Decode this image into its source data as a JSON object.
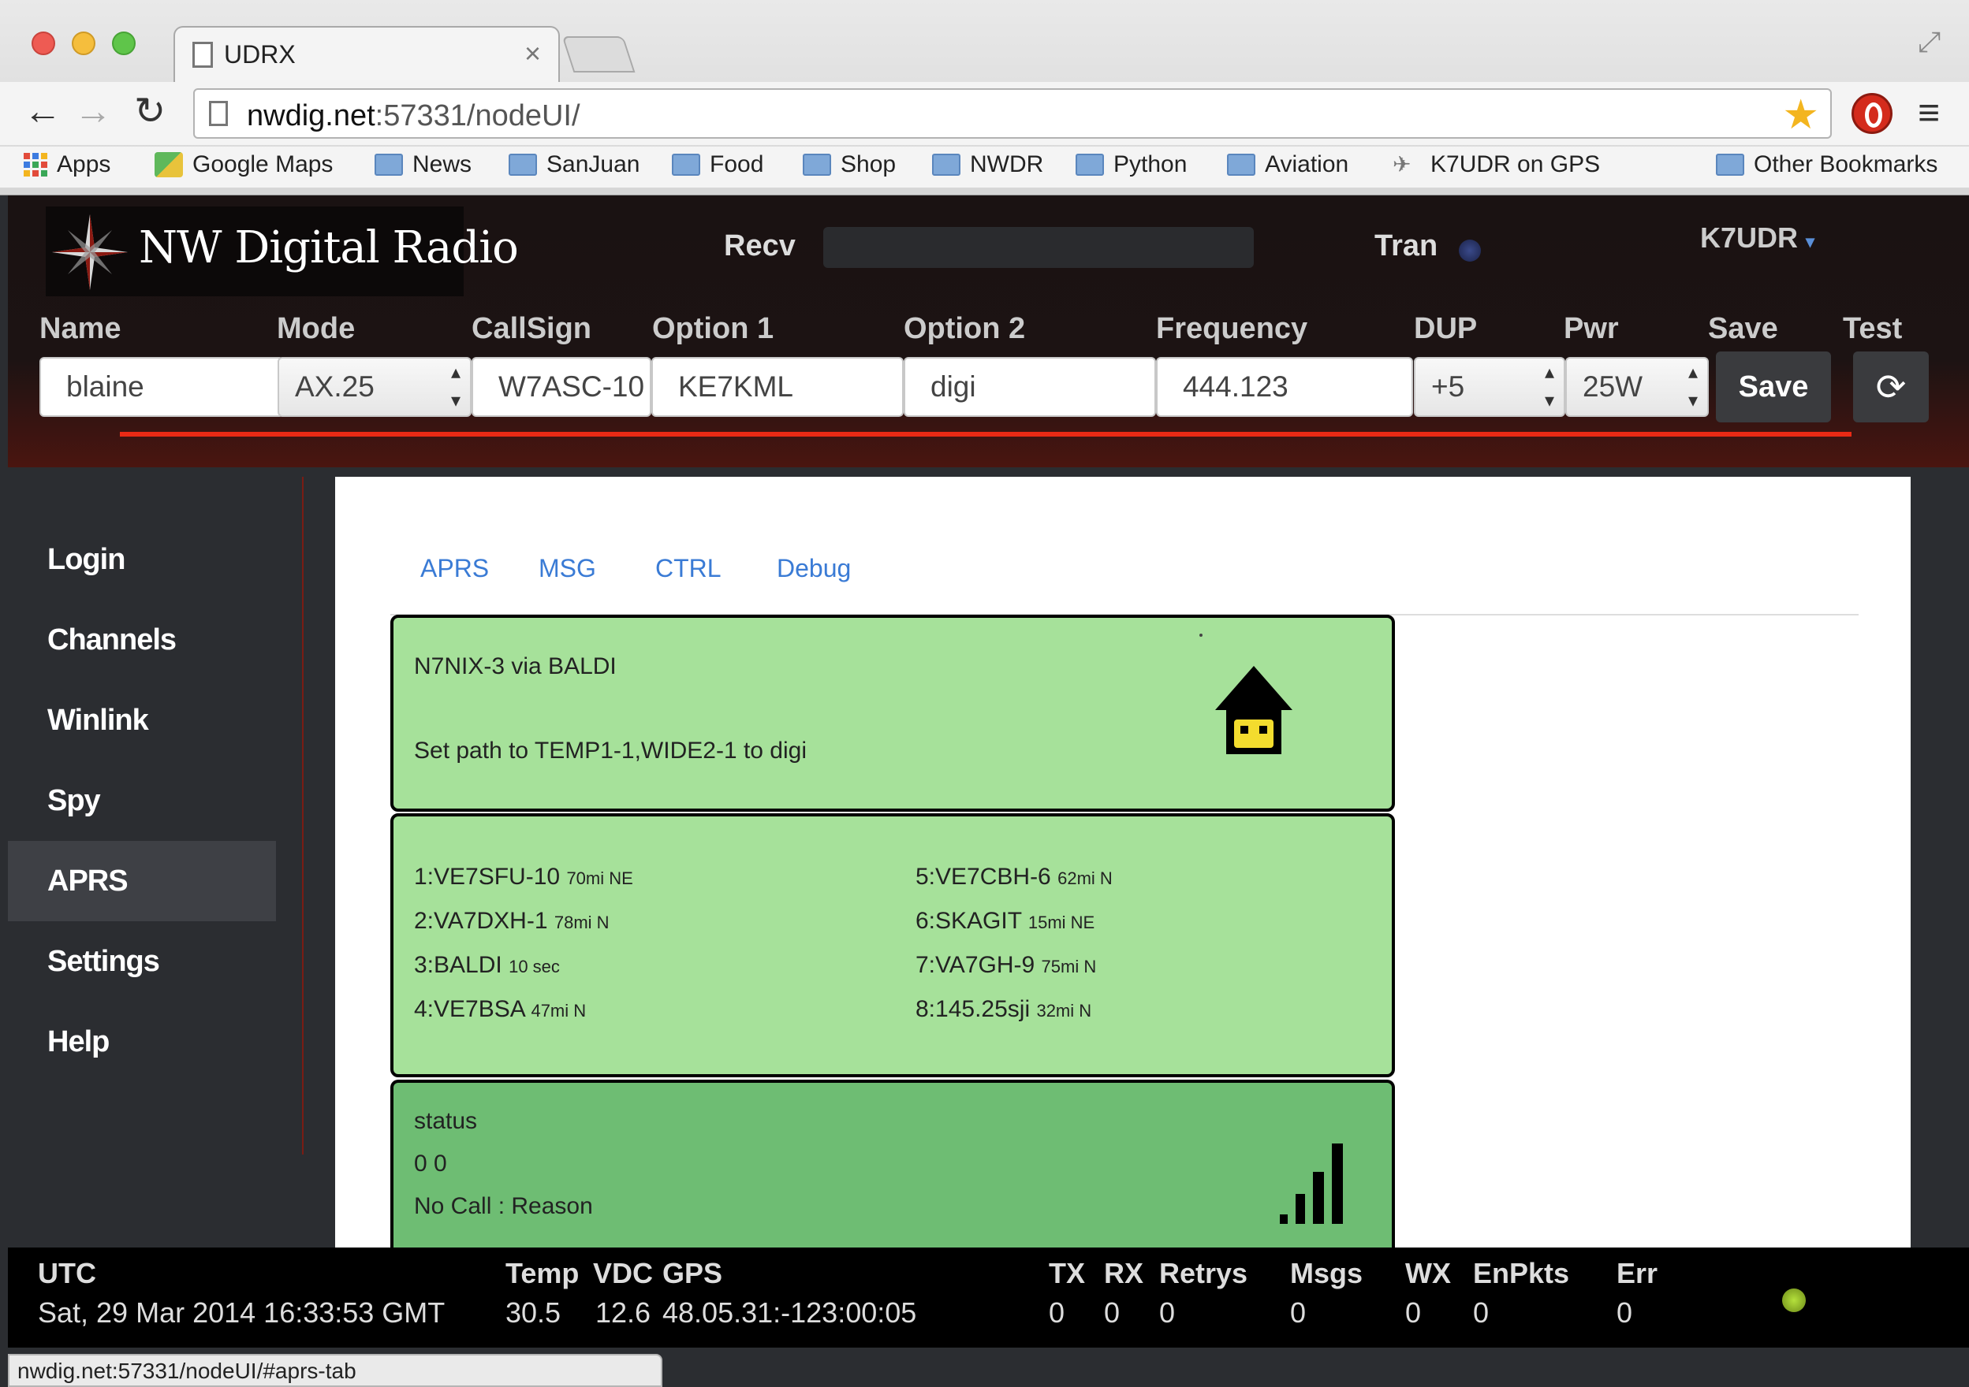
{
  "browser": {
    "tab_title": "UDRX",
    "url_host": "nwdig.net",
    "url_rest": ":57331/nodeUI/",
    "bookmarks": [
      "Apps",
      "Google Maps",
      "News",
      "SanJuan",
      "Food",
      "Shop",
      "NWDR",
      "Python",
      "Aviation",
      "K7UDR on GPS"
    ],
    "other_bookmarks": "Other Bookmarks",
    "status_url": "nwdig.net:57331/nodeUI/#aprs-tab"
  },
  "header": {
    "logo_text": "NW Digital Radio",
    "recv_label": "Recv",
    "tran_label": "Tran",
    "user": "K7UDR",
    "columns": {
      "name": "Name",
      "mode": "Mode",
      "callsign": "CallSign",
      "option1": "Option 1",
      "option2": "Option 2",
      "frequency": "Frequency",
      "dup": "DUP",
      "pwr": "Pwr",
      "save": "Save",
      "test": "Test"
    },
    "values": {
      "name": "blaine",
      "mode": "AX.25",
      "callsign": "W7ASC-10",
      "option1": "KE7KML",
      "option2": "digi",
      "frequency": "444.123",
      "dup": "+5",
      "pwr": "25W"
    },
    "save_button": "Save"
  },
  "sidebar": {
    "items": [
      "Login",
      "Channels",
      "Winlink",
      "Spy",
      "APRS",
      "Settings",
      "Help"
    ],
    "active": "APRS"
  },
  "tabs": [
    "APRS",
    "MSG",
    "CTRL",
    "Debug"
  ],
  "cards": {
    "station": {
      "line1": "N7NIX-3  via BALDI",
      "line2": "Set path to TEMP1-1,WIDE2-1 to digi",
      "icon": "house-icon"
    },
    "heard": [
      {
        "call": "1:VE7SFU-10",
        "detail": "70mi NE"
      },
      {
        "call": "2:VA7DXH-1",
        "detail": "78mi N"
      },
      {
        "call": "3:BALDI",
        "detail": "10 sec"
      },
      {
        "call": "4:VE7BSA",
        "detail": "47mi N"
      },
      {
        "call": "5:VE7CBH-6",
        "detail": "62mi N"
      },
      {
        "call": "6:SKAGIT",
        "detail": "15mi NE"
      },
      {
        "call": "7:VA7GH-9",
        "detail": "75mi N"
      },
      {
        "call": "8:145.25sji",
        "detail": "32mi N"
      }
    ],
    "status": {
      "line1": "status",
      "line2": "0 0",
      "line3": "No Call : Reason",
      "icon": "signal-bars-icon"
    }
  },
  "footer": {
    "utc_label": "UTC",
    "utc_value": "Sat, 29 Mar 2014 16:33:53 GMT",
    "temp_label": "Temp",
    "vdc_label": "VDC",
    "gps_label": "GPS",
    "temp": "30.5",
    "vdc": "12.6",
    "gps": "48.05.31:-123:00:05",
    "tx_label": "TX",
    "rx_label": "RX",
    "retrys_label": "Retrys",
    "msgs_label": "Msgs",
    "wx_label": "WX",
    "enpkts_label": "EnPkts",
    "err_label": "Err",
    "tx": "0",
    "rx": "0",
    "retrys": "0",
    "msgs": "0",
    "wx": "0",
    "enpkts": "0",
    "err": "0"
  },
  "colors": {
    "card_green": "#a6e19a",
    "status_green": "#6ebd73",
    "accent_red": "#ea2a15",
    "tab_blue": "#3a7bd5",
    "led_green": "#b4e03c"
  }
}
